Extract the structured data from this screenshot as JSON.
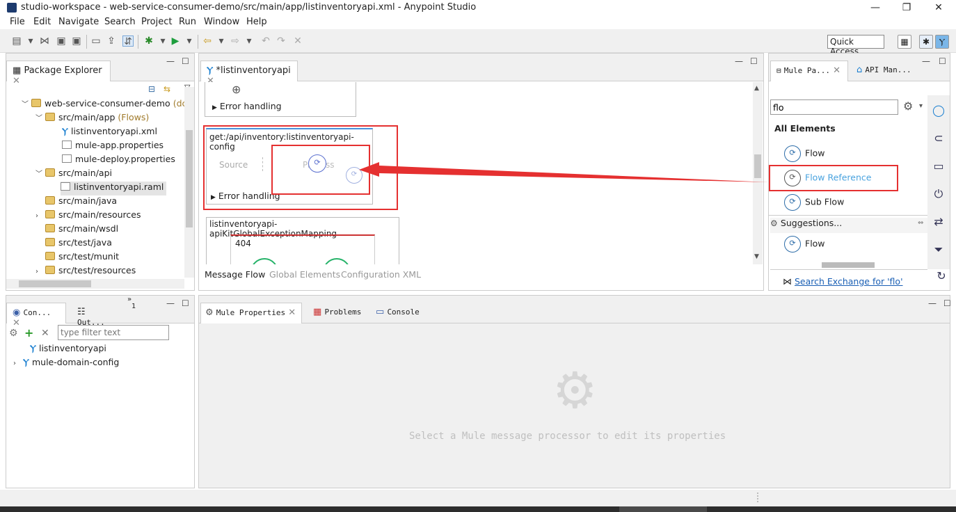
{
  "window": {
    "title": "studio-workspace - web-service-consumer-demo/src/main/app/listinventoryapi.xml - Anypoint Studio",
    "minimize": "—",
    "restore": "❐",
    "close": "✕"
  },
  "menu": [
    "File",
    "Edit",
    "Navigate",
    "Search",
    "Project",
    "Run",
    "Window",
    "Help"
  ],
  "toolbar": {
    "quick_access": "Quick Access"
  },
  "package_explorer": {
    "tab_label": "Package Explorer",
    "project": "web-service-consumer-demo",
    "project_suffix": "(dc",
    "items": [
      {
        "label": "src/main/app",
        "suffix": "(Flows)"
      },
      {
        "label": "listinventoryapi.xml"
      },
      {
        "label": "mule-app.properties"
      },
      {
        "label": "mule-deploy.properties"
      },
      {
        "label": "src/main/api"
      },
      {
        "label": "listinventoryapi.raml"
      },
      {
        "label": "src/main/java"
      },
      {
        "label": "src/main/resources"
      },
      {
        "label": "src/main/wsdl"
      },
      {
        "label": "src/test/java"
      },
      {
        "label": "src/test/munit"
      },
      {
        "label": "src/test/resources"
      }
    ]
  },
  "editor": {
    "tab_label": "*listinventoryapi",
    "error_handling_1": "Error handling",
    "flow_title": "get:/api/inventory:listinventoryapi-config",
    "source_label": "Source",
    "process_label": "Process",
    "error_handling_2": "Error handling",
    "exception_title": "listinventoryapi-apiKitGlobalExceptionMapping",
    "code_404": "404",
    "bottom_tabs": [
      "Message Flow",
      "Global Elements",
      "Configuration XML"
    ]
  },
  "palette": {
    "tab1": "Mule Pa...",
    "tab2": "API Man...",
    "search_value": "flo",
    "section_all": "All Elements",
    "elements": [
      "Flow",
      "Flow Reference",
      "Sub Flow"
    ],
    "suggestions_label": "Suggestions...",
    "suggestion_items": [
      "Flow"
    ],
    "exchange_link": "Search Exchange for 'flo'"
  },
  "outline": {
    "tab1": "Con...",
    "tab2": "Out...",
    "tab_count": "1",
    "filter_placeholder": "type filter text",
    "items": [
      "listinventoryapi",
      "mule-domain-config"
    ]
  },
  "properties": {
    "tabs": [
      "Mule Properties",
      "Problems",
      "Console"
    ],
    "empty_message": "Select a Mule message processor to edit its properties"
  },
  "colors": {
    "accent_red": "#e53030",
    "link_blue": "#1a5fb4",
    "highlight_text": "#4aa3df"
  }
}
